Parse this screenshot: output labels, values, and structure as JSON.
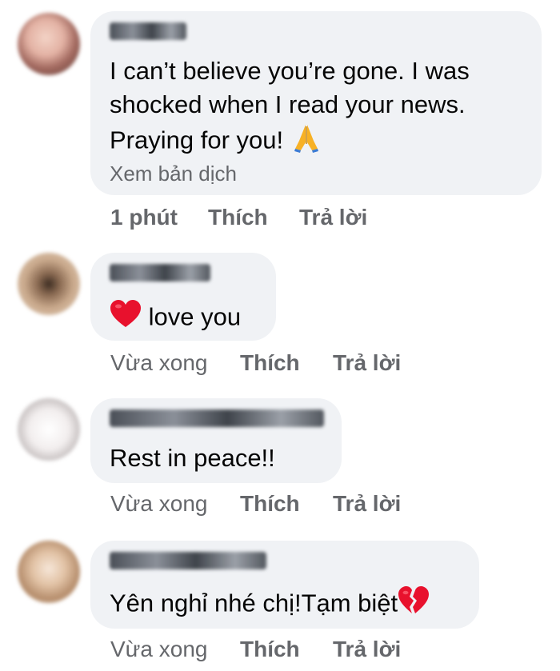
{
  "comments": [
    {
      "author": "",
      "text": "I can’t believe you’re gone. I was shocked when I read your news. Praying for you!",
      "lines": [
        "I can’t believe you’re gone. I was",
        "shocked when I read your news.",
        "Praying for you!"
      ],
      "emoji": "folded-hands-icon",
      "translate_label": "Xem bản dịch",
      "time": "1 phút",
      "like_label": "Thích",
      "reply_label": "Trả lời"
    },
    {
      "author": "",
      "text": "love you",
      "emoji": "red-heart-icon",
      "time": "Vừa xong",
      "like_label": "Thích",
      "reply_label": "Trả lời"
    },
    {
      "author": "",
      "text": "Rest in peace!!",
      "time": "Vừa xong",
      "like_label": "Thích",
      "reply_label": "Trả lời"
    },
    {
      "author": "",
      "text": "Yên nghỉ nhé chị!Tạm biệt",
      "emoji": "broken-heart-icon",
      "time": "Vừa xong",
      "like_label": "Thích",
      "reply_label": "Trả lời"
    }
  ],
  "colors": {
    "bubble": "#f0f2f5",
    "text": "#050505",
    "secondary": "#65676b",
    "heart": "#e8112d",
    "folded_hands": "#f7b125"
  }
}
